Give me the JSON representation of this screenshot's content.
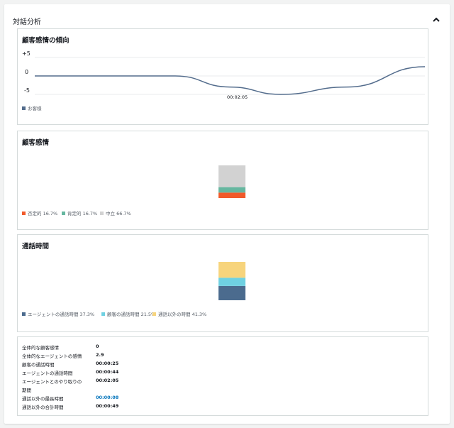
{
  "panel": {
    "title": "対話分析"
  },
  "trend": {
    "title": "顧客感情の傾向",
    "yticks": [
      "+5",
      "0",
      "-5"
    ],
    "xtick": "00:02:05",
    "legend": [
      {
        "label": "お客様",
        "color": "#536c8c"
      }
    ]
  },
  "sentiment": {
    "title": "顧客感情",
    "legend": [
      {
        "label": "否定的 16.7%",
        "color": "#f15a2b"
      },
      {
        "label": "肯定的 16.7%",
        "color": "#66b7a0"
      },
      {
        "label": "中立 66.7%",
        "color": "#d2d2d2"
      }
    ]
  },
  "talktime": {
    "title": "通話時間",
    "legend": [
      {
        "label": "エージェントの通話時間 37.3%",
        "color": "#4b6b8e"
      },
      {
        "label": "顧客の通話時間 21.5%",
        "color": "#6fd1e2"
      },
      {
        "label": "通話以外の時間 41.3%",
        "color": "#f7d47c"
      }
    ]
  },
  "summary": {
    "rows": [
      {
        "label": "全体的な顧客感情",
        "value": "0"
      },
      {
        "label": "全体的なエージェントの感情",
        "value": "2.9"
      },
      {
        "label": "顧客の通話時間",
        "value": "00:00:25"
      },
      {
        "label": "エージェントの通話時間",
        "value": "00:00:44"
      },
      {
        "label": "エージェントとのやり取りの",
        "label2": "期間",
        "value": "00:02:05"
      },
      {
        "label": "通話以外の最長時間",
        "value": "00:00:08",
        "link": true
      },
      {
        "label": "通話以外の合計時間",
        "value": "00:00:49"
      }
    ]
  },
  "chart_data": [
    {
      "type": "line",
      "title": "顧客感情の傾向",
      "x_ticks": [
        "00:02:05"
      ],
      "ylim": [
        -5,
        5
      ],
      "y_ticks": [
        "+5",
        "0",
        "-5"
      ],
      "series": [
        {
          "name": "お客様",
          "color": "#536c8c",
          "points": [
            [
              0,
              0
            ],
            [
              0.2,
              0
            ],
            [
              0.36,
              0
            ],
            [
              0.5,
              -3
            ],
            [
              0.63,
              -5
            ],
            [
              0.8,
              -3
            ],
            [
              1.0,
              2.5
            ]
          ]
        }
      ],
      "grid": true,
      "legend": "bottom-left"
    },
    {
      "type": "bar",
      "title": "顧客感情",
      "stacked": true,
      "series": [
        {
          "name": "否定的",
          "value": 16.7,
          "color": "#f15a2b"
        },
        {
          "name": "肯定的",
          "value": 16.7,
          "color": "#66b7a0"
        },
        {
          "name": "中立",
          "value": 66.7,
          "color": "#d2d2d2"
        }
      ],
      "legend": "bottom-left"
    },
    {
      "type": "bar",
      "title": "通話時間",
      "stacked": true,
      "series": [
        {
          "name": "エージェントの通話時間",
          "value": 37.3,
          "color": "#4b6b8e"
        },
        {
          "name": "顧客の通話時間",
          "value": 21.5,
          "color": "#6fd1e2"
        },
        {
          "name": "通話以外の時間",
          "value": 41.3,
          "color": "#f7d47c"
        }
      ],
      "legend": "bottom-left"
    }
  ]
}
